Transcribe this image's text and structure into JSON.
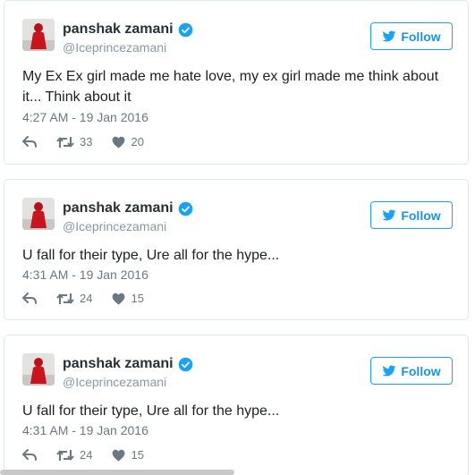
{
  "tweets": [
    {
      "display_name": "panshak zamani",
      "handle": "@Iceprincezamani",
      "follow_label": "Follow",
      "text": "My Ex Ex girl made me hate love, my ex girl made me think about it... Think about it",
      "timestamp": "4:27 AM - 19 Jan 2016",
      "retweets": "33",
      "likes": "20"
    },
    {
      "display_name": "panshak zamani",
      "handle": "@Iceprincezamani",
      "follow_label": "Follow",
      "text": "U fall for their type, Ure all for the hype...",
      "timestamp": "4:31 AM - 19 Jan 2016",
      "retweets": "24",
      "likes": "15"
    },
    {
      "display_name": "panshak zamani",
      "handle": "@Iceprincezamani",
      "follow_label": "Follow",
      "text": "U fall for their type, Ure all for the hype...",
      "timestamp": "4:31 AM - 19 Jan 2016",
      "retweets": "24",
      "likes": "15"
    }
  ],
  "icons": {
    "verified": "verified-badge-icon",
    "follow": "twitter-bird-icon",
    "reply": "reply-icon",
    "retweet": "retweet-icon",
    "like": "heart-icon"
  },
  "colors": {
    "accent": "#1da1f2",
    "follow_text": "#1b95e0",
    "muted": "#697882",
    "handle": "#8899a6",
    "border": "#e1e8ed"
  }
}
